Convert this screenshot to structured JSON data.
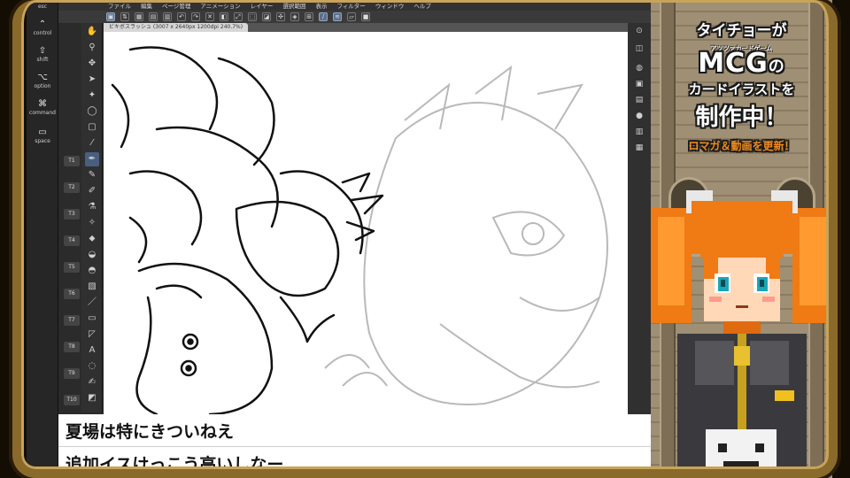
{
  "menu": [
    "ファイル",
    "編集",
    "ページ管理",
    "アニメーション",
    "レイヤー",
    "選択範囲",
    "表示",
    "フィルター",
    "ウィンドウ",
    "ヘルプ"
  ],
  "doc_tab": "ビキボスラッシュ (3007 x 2640px 1200dpi 240.7%)",
  "keystrip": {
    "esc": "esc",
    "control": "control",
    "shift": "shift",
    "option": "option",
    "command": "command",
    "space": "space"
  },
  "tool_labels": [
    "T1",
    "T2",
    "T3",
    "T4",
    "T5",
    "T6",
    "T7",
    "T8",
    "T9",
    "T10"
  ],
  "subtitles": {
    "line1": "夏場は特にきついねえ",
    "line2": "追加イスけっこう高いしなー"
  },
  "promo": {
    "line1": "タイチョーが",
    "line2_small": "アツツァカードゲーム",
    "line3": "MCG",
    "line3_suffix": "の",
    "line4": "カードイラストを",
    "line5": "制作中！",
    "line6": "ロマガ＆動画を更新！"
  },
  "colors": {
    "accent_orange": "#f08a1c",
    "app_dark": "#2b2b2b",
    "active_tool": "#4a5f80"
  }
}
